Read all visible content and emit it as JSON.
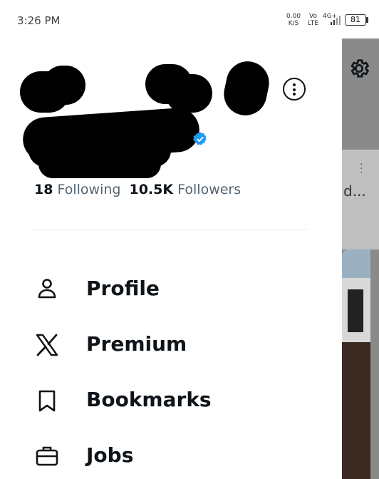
{
  "status_bar": {
    "time": "3:26 PM",
    "speed_value": "0.00",
    "speed_unit": "K/S",
    "volte_top": "Vo",
    "volte_bottom": "LTE",
    "network": "4G+",
    "battery": "81"
  },
  "profile": {
    "following_count": "18",
    "following_label": "Following",
    "followers_count": "10.5K",
    "followers_label": "Followers"
  },
  "menu": {
    "items": [
      {
        "label": "Profile",
        "icon": "person-icon"
      },
      {
        "label": "Premium",
        "icon": "x-logo-icon"
      },
      {
        "label": "Bookmarks",
        "icon": "bookmark-icon"
      },
      {
        "label": "Jobs",
        "icon": "briefcase-icon"
      }
    ]
  },
  "background": {
    "truncated_text": "d..."
  },
  "colors": {
    "text_primary": "#0f1419",
    "text_secondary": "#536471",
    "verified_blue": "#1d9bf0",
    "divider": "#e7e7e7"
  }
}
